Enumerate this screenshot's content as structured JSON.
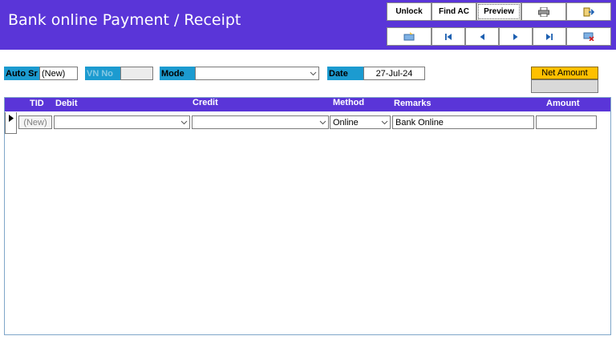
{
  "window": {
    "title": "Bank online Payment / Receipt"
  },
  "toolbar": {
    "unlock_label": "Unlock",
    "find_ac_label": "Find AC",
    "preview_label": "Preview",
    "icons": [
      "print-icon",
      "export-icon",
      "new-record-icon",
      "first-record-icon",
      "previous-record-icon",
      "next-record-icon",
      "last-record-icon",
      "delete-record-icon"
    ]
  },
  "form": {
    "auto_sr_label": "Auto Sr",
    "auto_sr_value": "(New)",
    "vn_no_label": "VN No",
    "vn_no_value": "",
    "mode_label": "Mode",
    "mode_value": "",
    "date_label": "Date",
    "date_value": "27-Jul-24",
    "net_amount_label": "Net Amount",
    "net_amount_value": ""
  },
  "grid": {
    "columns": [
      "TID",
      "Debit",
      "Credit",
      "Method",
      "Remarks",
      "Amount"
    ],
    "rows": [
      {
        "tid": "(New)",
        "debit": "",
        "credit": "",
        "method": "Online",
        "remarks": "Bank Online",
        "amount": ""
      }
    ]
  },
  "colors": {
    "header": "#5a35d8",
    "label_blue": "#1c9bd0",
    "net_amount": "#ffc000"
  }
}
